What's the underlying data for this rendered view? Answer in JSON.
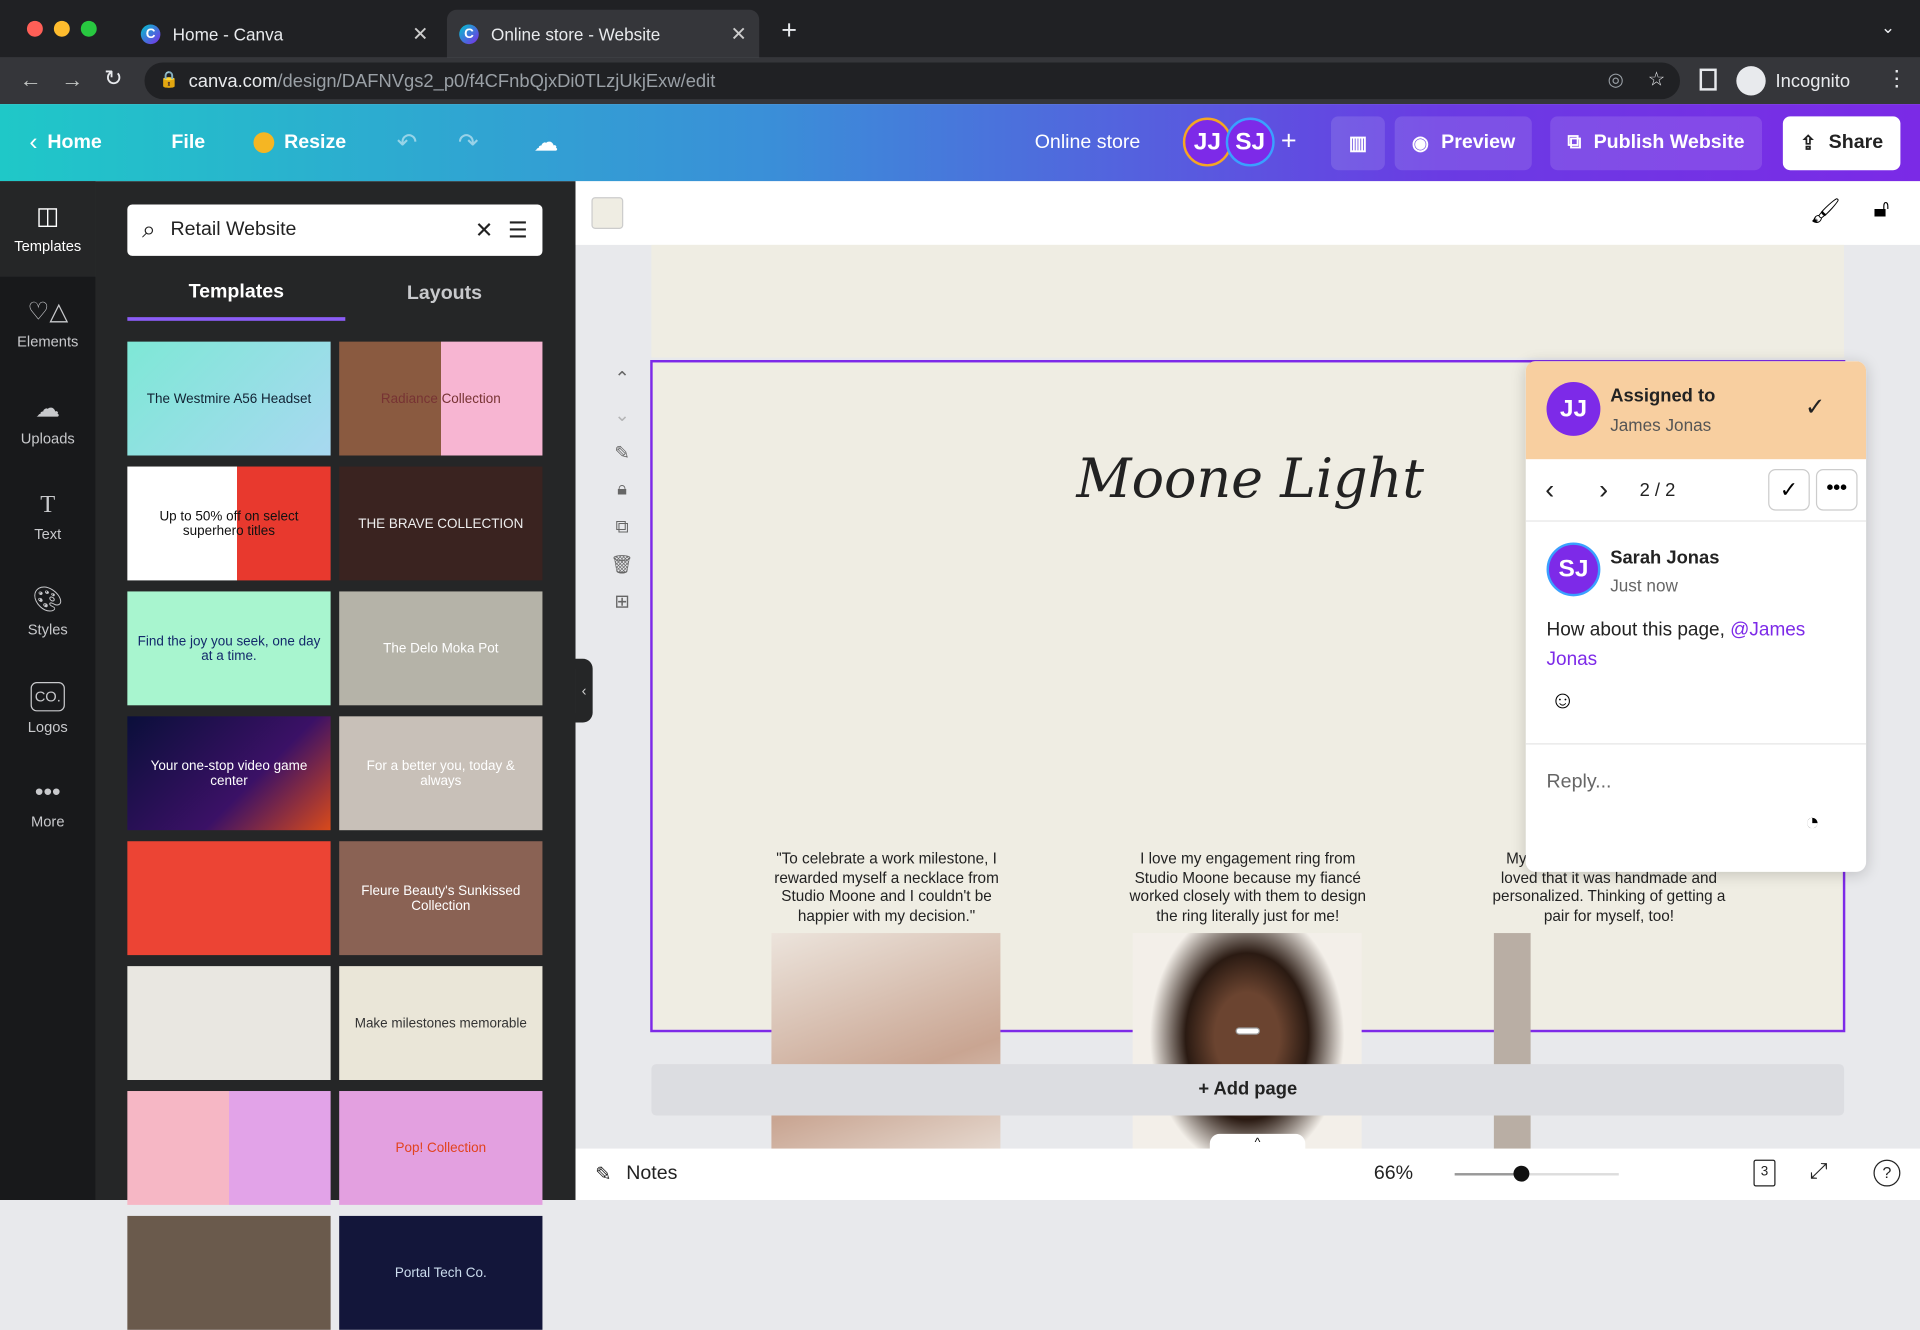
{
  "browser": {
    "tabs": [
      {
        "label": "Home - Canva",
        "active": false
      },
      {
        "label": "Online store - Website",
        "active": true
      }
    ],
    "url_domain": "canva.com",
    "url_path": "/design/DAFNVgs2_p0/f4CFnbQjxDi0TLzjUkjExw/edit",
    "profile": "Incognito"
  },
  "header": {
    "home": "Home",
    "file": "File",
    "resize": "Resize",
    "title": "Online store",
    "collaborators": [
      {
        "initials": "JJ",
        "ring": "#f5a623"
      },
      {
        "initials": "SJ",
        "ring": "#3aa0ff"
      }
    ],
    "preview": "Preview",
    "publish": "Publish Website",
    "share": "Share"
  },
  "rail": [
    {
      "label": "Templates",
      "icon": "layout-icon"
    },
    {
      "label": "Elements",
      "icon": "shapes-icon"
    },
    {
      "label": "Uploads",
      "icon": "cloud-upload-icon"
    },
    {
      "label": "Text",
      "icon": "text-icon"
    },
    {
      "label": "Styles",
      "icon": "palette-icon"
    },
    {
      "label": "Logos",
      "icon": "logo-icon"
    },
    {
      "label": "More",
      "icon": "more-icon"
    }
  ],
  "panel": {
    "search_value": "Retail Website",
    "tabs": [
      "Templates",
      "Layouts"
    ],
    "thumbnails": [
      "The Westmire A56 Headset",
      "Radiance Collection",
      "Up to 50% off on select superhero titles",
      "THE BRAVE COLLECTION",
      "Find the joy you seek, one day at a time.",
      "The Delo Moka Pot",
      "Your one-stop video game center",
      "For a better you, today & always",
      "",
      "Fleure Beauty's Sunkissed Collection",
      "",
      "Make milestones memorable",
      "",
      "Pop! Collection",
      "",
      "Portal Tech Co."
    ]
  },
  "design": {
    "title": "Moone Light",
    "quotes": [
      "\"To celebrate a work milestone, I rewarded myself a necklace from Studio Moone and I couldn't be happier with my decision.\"",
      "I love my engagement ring from Studio Moone because my fiancé worked closely with them to design the ring literally just for me!",
      "My ... her for her birthday. She loved that it was handmade and personalized. Thinking of getting a pair for myself, too!"
    ],
    "add_page": "+ Add page",
    "accent": "#7d2ae8"
  },
  "comment": {
    "assigned_label": "Assigned to",
    "assignee": "James Jonas",
    "assignee_initials": "JJ",
    "counter": "2 / 2",
    "author": "Sarah Jonas",
    "author_initials": "SJ",
    "time": "Just now",
    "text": "How about this page, ",
    "mention": "@James Jonas",
    "reply_placeholder": "Reply...",
    "header_color": "#f8cfa0"
  },
  "bottom": {
    "notes": "Notes",
    "zoom": "66%",
    "zoom_fraction": 0.4,
    "pages": "3"
  }
}
